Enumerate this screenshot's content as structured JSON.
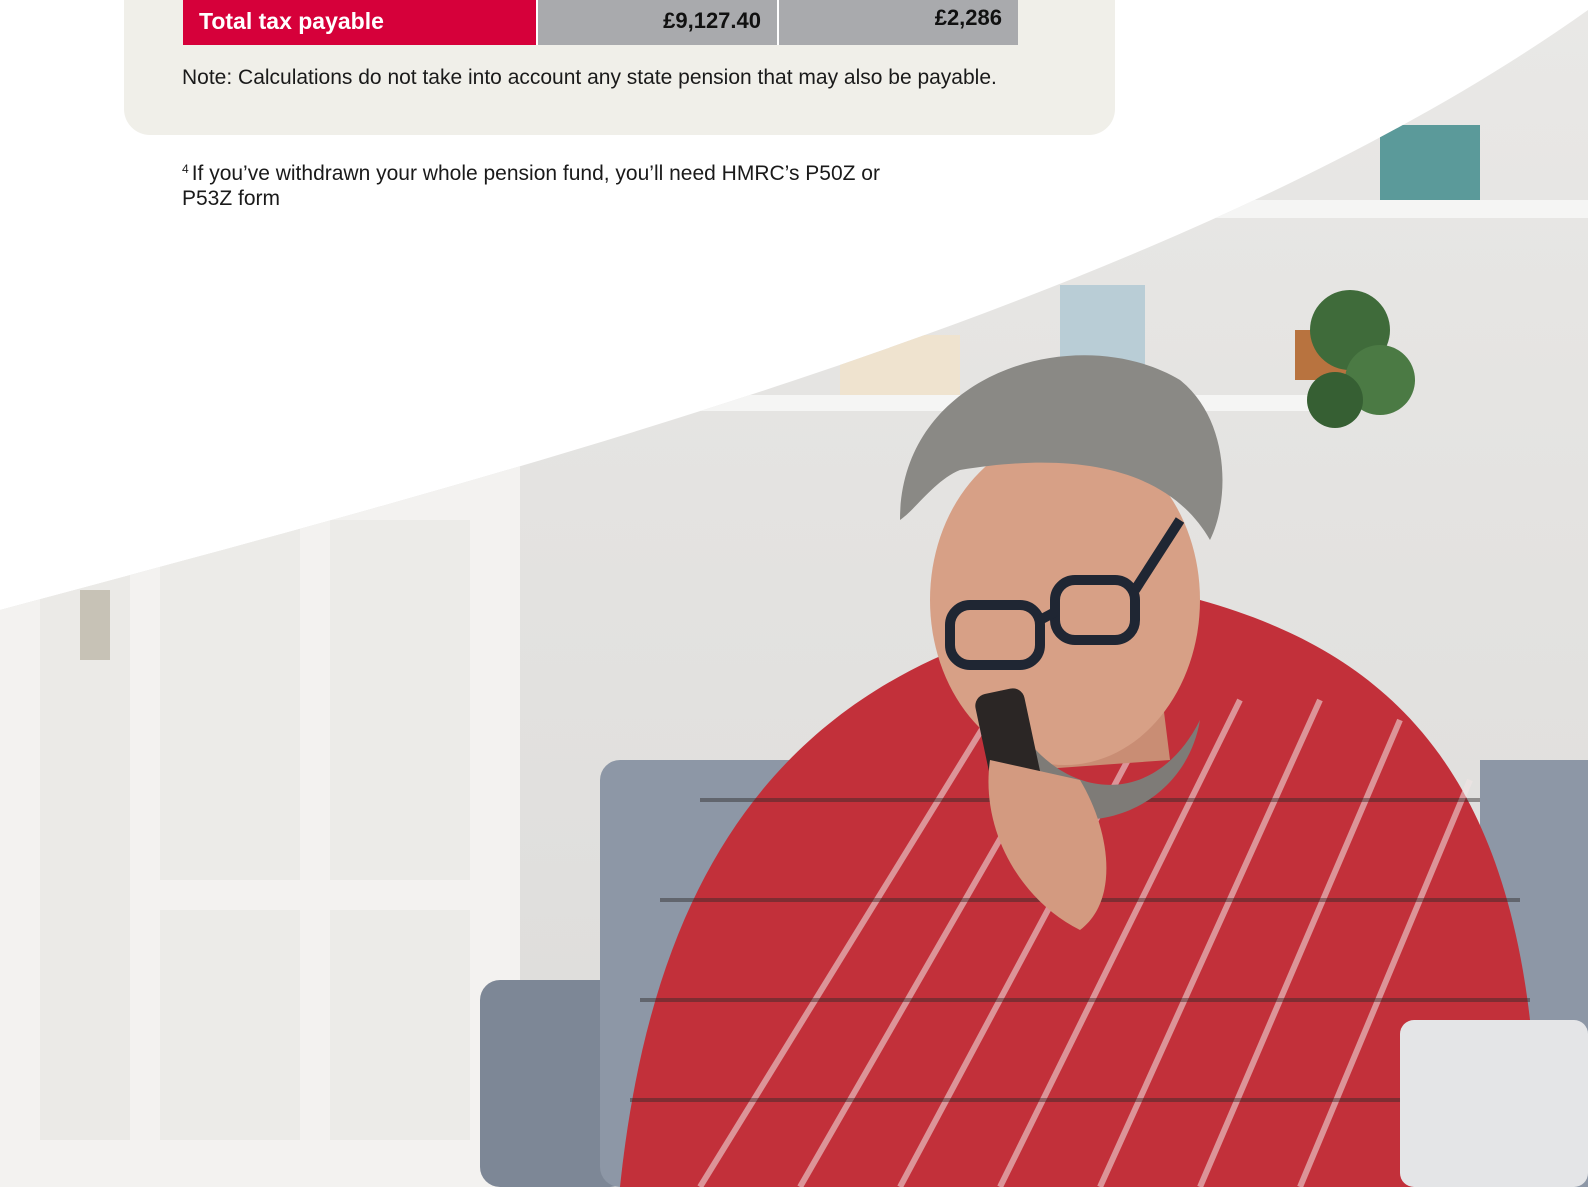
{
  "table": {
    "total_row": {
      "label": "Total tax payable",
      "value_1": "£9,127.40",
      "value_2": "£2,286"
    }
  },
  "note": "Note: Calculations do not take into account any state pension that may also be payable.",
  "footnote": {
    "marker": "4",
    "text": "If you’ve withdrawn your whole pension fund, you’ll need HMRC’s P50Z or P53Z form"
  },
  "colors": {
    "accent_red": "#d6003a",
    "value_grey": "#a9aaad",
    "card_background": "#f0efe9"
  }
}
